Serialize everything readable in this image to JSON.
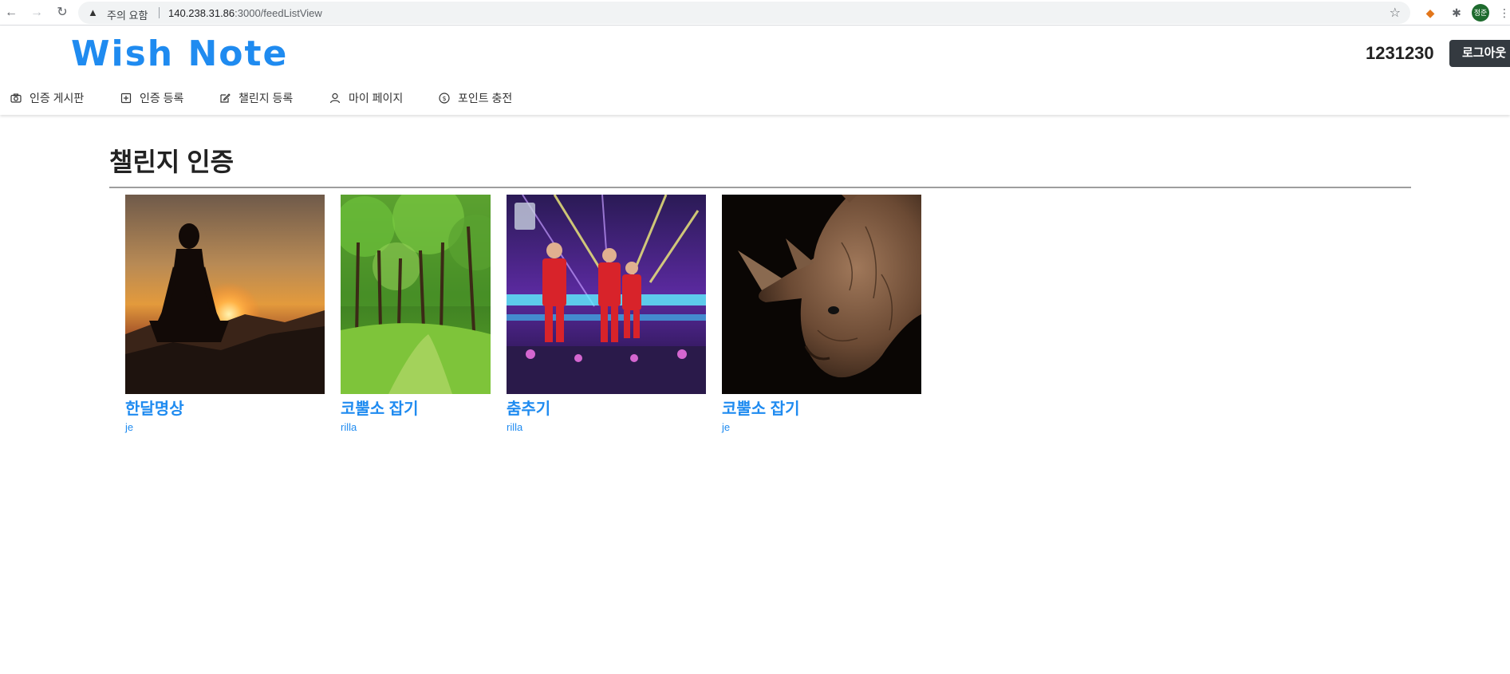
{
  "browser": {
    "warning_text": "주의 요함",
    "url_host": "140.238.31.86",
    "url_path": ":3000/feedListView",
    "avatar_text": "정준"
  },
  "header": {
    "brand": "Wish Note",
    "user_id": "1231230",
    "logout_label": "로그아웃"
  },
  "menu": [
    {
      "label": "인증 게시판",
      "icon": "camera-icon"
    },
    {
      "label": "인증 등록",
      "icon": "plus-square-icon"
    },
    {
      "label": "챌린지 등록",
      "icon": "edit-icon"
    },
    {
      "label": "마이 페이지",
      "icon": "user-icon"
    },
    {
      "label": "포인트 충전",
      "icon": "coin-icon"
    }
  ],
  "page": {
    "title": "챌린지 인증"
  },
  "feed": [
    {
      "title": "한달명상",
      "author": "je",
      "image": "meditation-sunset-image"
    },
    {
      "title": "코뿔소 잡기",
      "author": "rilla",
      "image": "forest-path-image"
    },
    {
      "title": "춤추기",
      "author": "rilla",
      "image": "dance-stage-image"
    },
    {
      "title": "코뿔소 잡기",
      "author": "je",
      "image": "rhino-image"
    }
  ],
  "colors": {
    "brand": "#1f8bf0",
    "logout_bg": "#343a40"
  }
}
